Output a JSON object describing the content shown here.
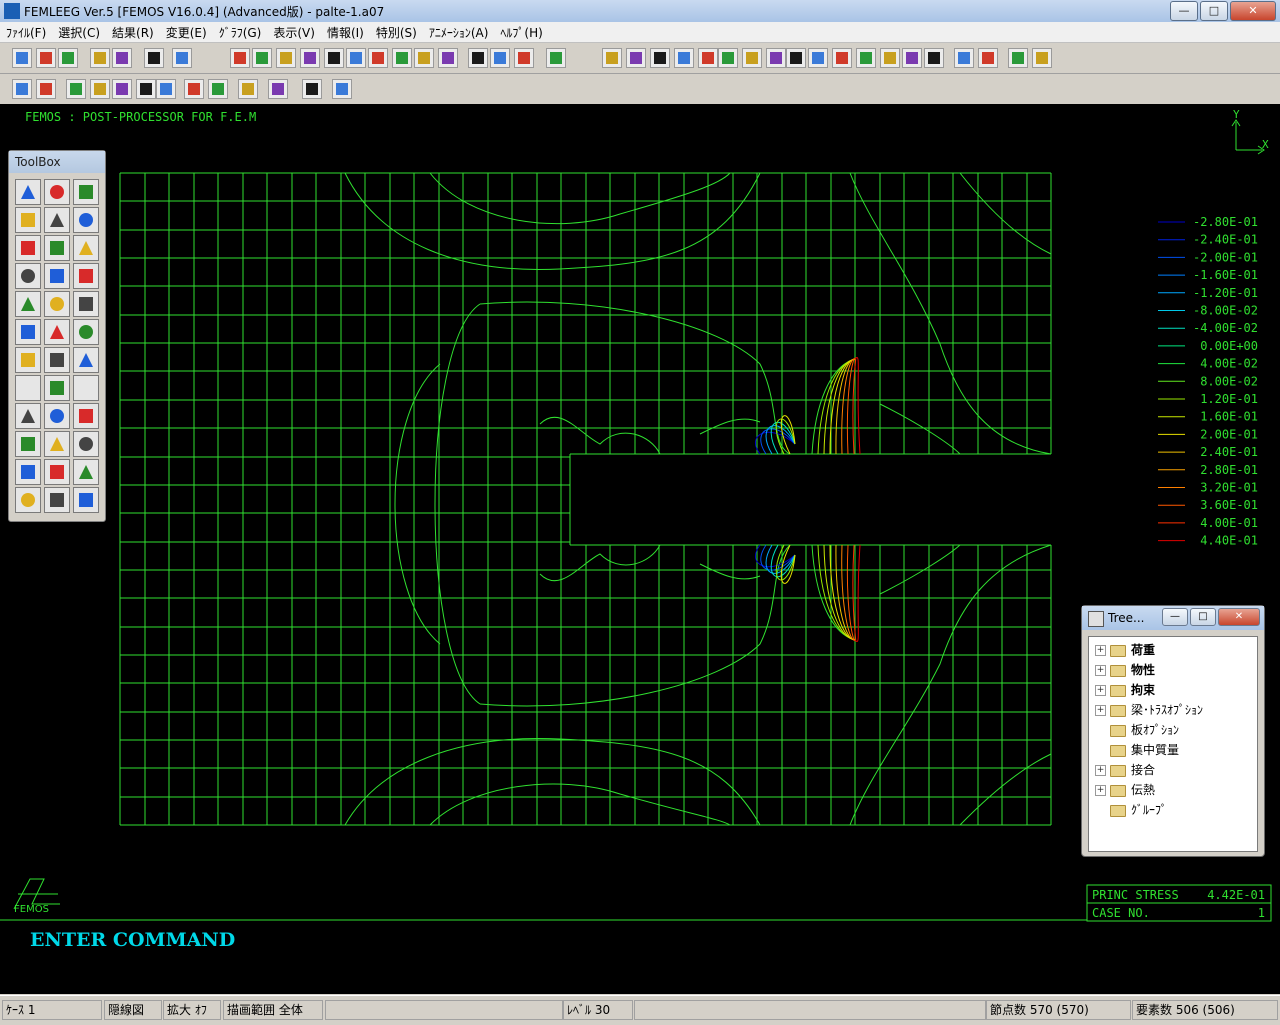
{
  "window": {
    "title": "FEMLEEG Ver.5 [FEMOS V16.0.4] (Advanced版) - palte-1.a07",
    "minimize": "—",
    "maximize": "□",
    "close": "✕"
  },
  "menu": [
    "ﾌｧｲﾙ(F)",
    "選択(C)",
    "結果(R)",
    "変更(E)",
    "ｸﾞﾗﾌ(G)",
    "表示(V)",
    "情報(I)",
    "特別(S)",
    "ｱﾆﾒｰｼｮﾝ(A)",
    "ﾍﾙﾌﾟ(H)"
  ],
  "viewport": {
    "header": "FEMOS   :  POST-PROCESSOR   FOR  F.E.M",
    "axis_y": "Y",
    "axis_x": "X",
    "command_prompt": "ENTER COMMAND",
    "logo_text": "FEMOS",
    "result_label": "PRINC STRESS",
    "result_value": "4.42E-01",
    "case_label": "CASE NO.",
    "case_value": "1",
    "mesh_color": "#30e030",
    "text_color": "#30e030",
    "prompt_color": "#00d8e8"
  },
  "legend": [
    {
      "label": "-2.80E-01",
      "color": "#0000c8"
    },
    {
      "label": "-2.40E-01",
      "color": "#0020e0"
    },
    {
      "label": "-2.00E-01",
      "color": "#0050f0"
    },
    {
      "label": "-1.60E-01",
      "color": "#0080ff"
    },
    {
      "label": "-1.20E-01",
      "color": "#00a8ff"
    },
    {
      "label": "-8.00E-02",
      "color": "#00c8e8"
    },
    {
      "label": "-4.00E-02",
      "color": "#00e0c0"
    },
    {
      "label": "0.00E+00",
      "color": "#00e880"
    },
    {
      "label": "4.00E-02",
      "color": "#20e840"
    },
    {
      "label": "8.00E-02",
      "color": "#60e820"
    },
    {
      "label": "1.20E-01",
      "color": "#98e800"
    },
    {
      "label": "1.60E-01",
      "color": "#c8e800"
    },
    {
      "label": "2.00E-01",
      "color": "#e8e000"
    },
    {
      "label": "2.40E-01",
      "color": "#f0c000"
    },
    {
      "label": "2.80E-01",
      "color": "#f8a000"
    },
    {
      "label": "3.20E-01",
      "color": "#ff8000"
    },
    {
      "label": "3.60E-01",
      "color": "#ff5800"
    },
    {
      "label": "4.00E-01",
      "color": "#ff3000"
    },
    {
      "label": "4.40E-01",
      "color": "#e00000"
    }
  ],
  "toolbox": {
    "title": "ToolBox",
    "icons": [
      "mirror-icon",
      "renumber-icon",
      "check-icon",
      "view-front-icon",
      "view-side-icon",
      "view-top-icon",
      "view-iso-icon",
      "view-rotate-icon",
      "view-hand-icon",
      "axis-yx-icon",
      "axis-zx-icon",
      "axis-zy-icon",
      "rotate-x-icon",
      "rotate-y-icon",
      "rotate-z-icon",
      "perspective-icon",
      "move-up-icon",
      "plus-minus-icon",
      "move-left-icon",
      "axis-xyz-icon",
      "move-right-icon",
      "blank-icon",
      "move-down-icon",
      "blank-icon",
      "rotate-free-icon",
      "pan-icon",
      "zoom-icon",
      "list-icon",
      "play-icon",
      "printer-icon",
      "tree-icon",
      "hatch-icon",
      "pen-icon",
      "undo-icon",
      "color-bar-icon",
      "redo-icon"
    ]
  },
  "tree": {
    "title": "Tree...",
    "minimize": "—",
    "maximize": "□",
    "close": "✕",
    "nodes": [
      {
        "label": "荷重",
        "expandable": true,
        "bold": true
      },
      {
        "label": "物性",
        "expandable": true,
        "bold": true
      },
      {
        "label": "拘束",
        "expandable": true,
        "bold": true
      },
      {
        "label": "梁･ﾄﾗｽｵﾌﾟｼｮﾝ",
        "expandable": true,
        "bold": false
      },
      {
        "label": "板ｵﾌﾟｼｮﾝ",
        "expandable": false,
        "bold": false
      },
      {
        "label": "集中質量",
        "expandable": false,
        "bold": false
      },
      {
        "label": "接合",
        "expandable": true,
        "bold": false
      },
      {
        "label": "伝熱",
        "expandable": true,
        "bold": false
      },
      {
        "label": "ｸﾞﾙｰﾌﾟ",
        "expandable": false,
        "bold": false
      }
    ]
  },
  "status": {
    "case": "ｹｰｽ 1",
    "mode": "隠線図",
    "zoom": "拡大 ｵﾌ",
    "range": "描画範囲 全体",
    "level": "ﾚﾍﾞﾙ 30",
    "nodes": "節点数 570 (570)",
    "elements": "要素数 506 (506)"
  }
}
